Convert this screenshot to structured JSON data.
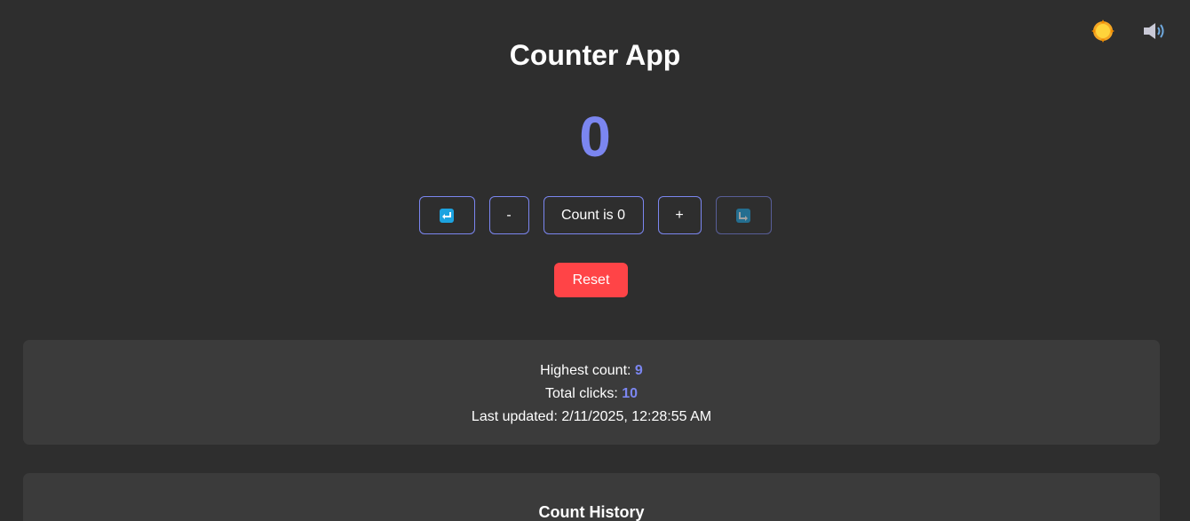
{
  "header": {
    "title": "Counter App",
    "theme_icon": "sun-icon",
    "sound_icon": "speaker-icon"
  },
  "counter": {
    "value": "0",
    "decrement_label": "-",
    "display_label": "Count is 0",
    "increment_label": "+",
    "undo_icon": "undo-icon",
    "redo_icon": "redo-icon",
    "reset_label": "Reset"
  },
  "stats": {
    "highest_label": "Highest count: ",
    "highest_value": "9",
    "clicks_label": "Total clicks: ",
    "clicks_value": "10",
    "updated_label": "Last updated: ",
    "updated_value": "2/11/2025, 12:28:55 AM"
  },
  "history": {
    "title": "Count History"
  },
  "colors": {
    "background": "#2e2e2e",
    "card": "#3b3b3b",
    "accent": "#7b86f0",
    "reset": "#ff4447"
  }
}
